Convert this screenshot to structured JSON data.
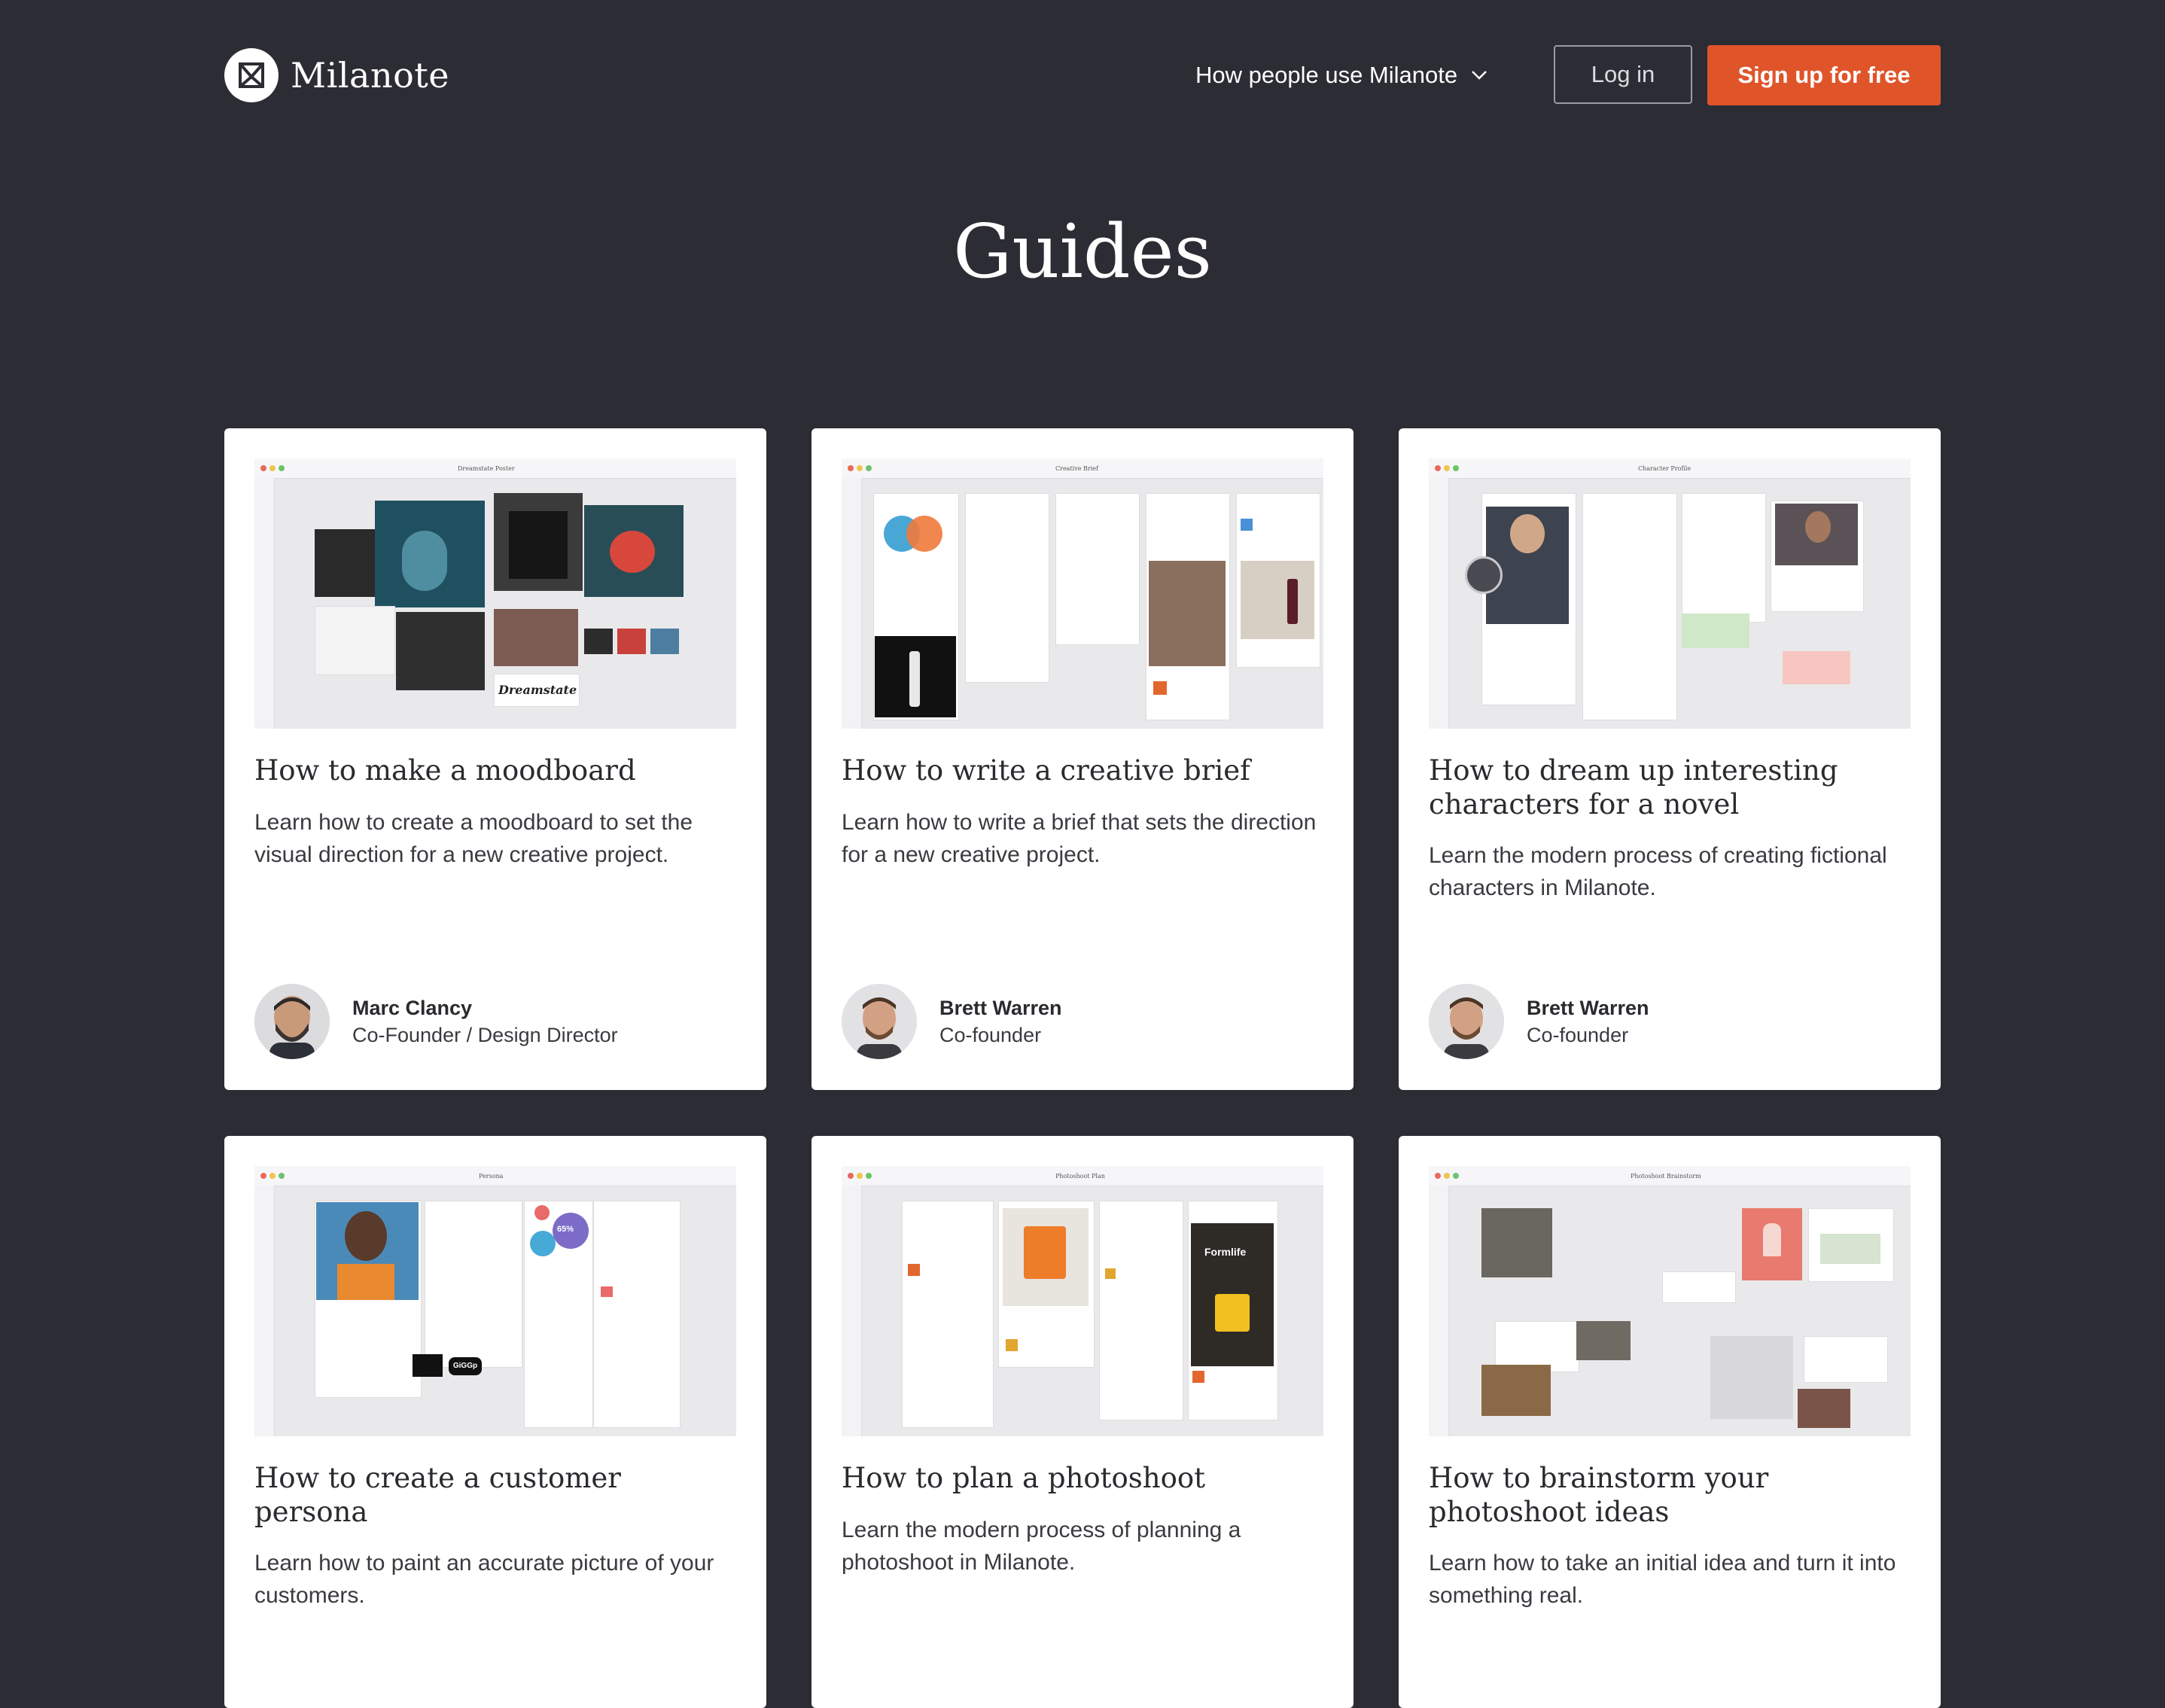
{
  "header": {
    "brand": "Milanote",
    "nav_dropdown": "How people use Milanote",
    "login": "Log in",
    "signup": "Sign up for free"
  },
  "page": {
    "title": "Guides"
  },
  "colors": {
    "background": "#2c2c35",
    "accent": "#e0542a",
    "card": "#ffffff"
  },
  "cards": [
    {
      "title": "How to make a moodboard",
      "description": "Learn how to create a moodboard to set the visual direction for a new creative project.",
      "board_title": "Dreamstate Poster",
      "board_word": "Dreamstate",
      "author_name": "Marc Clancy",
      "author_role": "Co-Founder / Design Director"
    },
    {
      "title": "How to write a creative brief",
      "description": "Learn how to write a brief that sets the direction for a new creative project.",
      "board_title": "Creative Brief",
      "author_name": "Brett Warren",
      "author_role": "Co-founder"
    },
    {
      "title": "How to dream up interesting characters for a novel",
      "description": "Learn the modern process of creating fictional characters in Milanote.",
      "board_title": "Character Profile",
      "author_name": "Brett Warren",
      "author_role": "Co-founder"
    },
    {
      "title": "How to create a customer persona",
      "description": "Learn how to paint an accurate picture of your customers.",
      "board_title": "Persona",
      "board_stat": "65%",
      "board_word": "GiGGp"
    },
    {
      "title": "How to plan a photoshoot",
      "description": "Learn the modern process of planning a photoshoot in Milanote.",
      "board_title": "Photoshoot Plan",
      "board_word": "Formlife"
    },
    {
      "title": "How to brainstorm your photoshoot ideas",
      "description": "Learn how to take an initial idea and turn it into something real.",
      "board_title": "Photoshoot Brainstorm"
    }
  ]
}
